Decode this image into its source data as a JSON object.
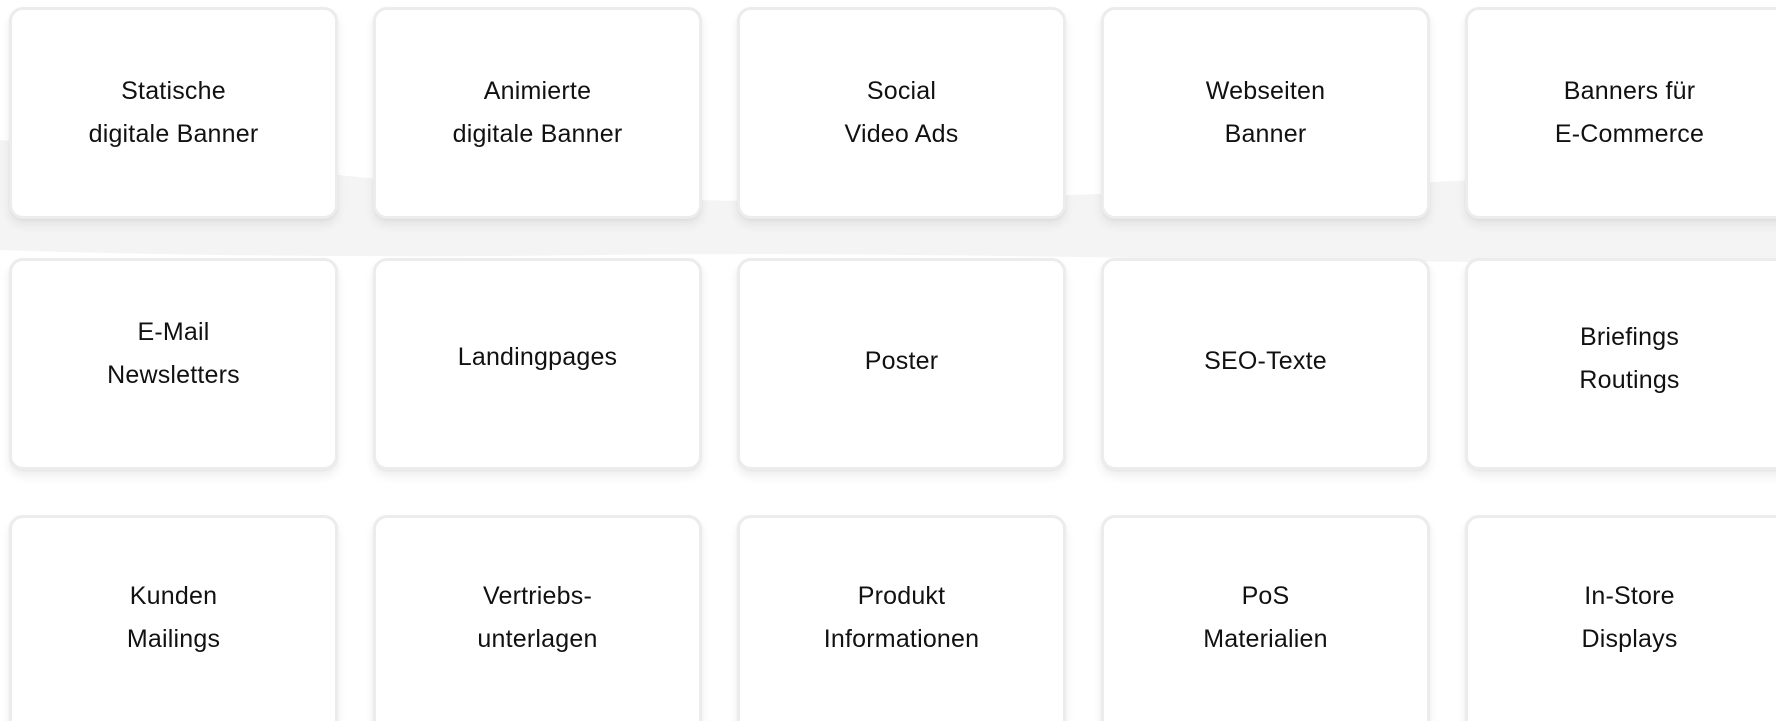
{
  "cards": [
    {
      "line1": "Statische",
      "line2": "digitale Banner"
    },
    {
      "line1": "Animierte",
      "line2": "digitale Banner"
    },
    {
      "line1": "Social",
      "line2": "Video Ads"
    },
    {
      "line1": "Webseiten",
      "line2": "Banner"
    },
    {
      "line1": "Banners für",
      "line2": "E-Commerce"
    },
    {
      "line1": "E-Mail",
      "line2": "Newsletters"
    },
    {
      "line1": "Landingpages",
      "line2": ""
    },
    {
      "line1": "Poster",
      "line2": ""
    },
    {
      "line1": "SEO-Texte",
      "line2": ""
    },
    {
      "line1": "Briefings",
      "line2": "Routings"
    },
    {
      "line1": "Kunden",
      "line2": "Mailings"
    },
    {
      "line1": "Vertriebs-",
      "line2": "unterlagen"
    },
    {
      "line1": "Produkt",
      "line2": "Informationen"
    },
    {
      "line1": "PoS",
      "line2": "Materialien"
    },
    {
      "line1": "In-Store",
      "line2": "Displays"
    }
  ],
  "colors": {
    "background": "#ffffff",
    "wave": "#f4f4f5",
    "card_border": "#ececec",
    "text": "#111111"
  }
}
